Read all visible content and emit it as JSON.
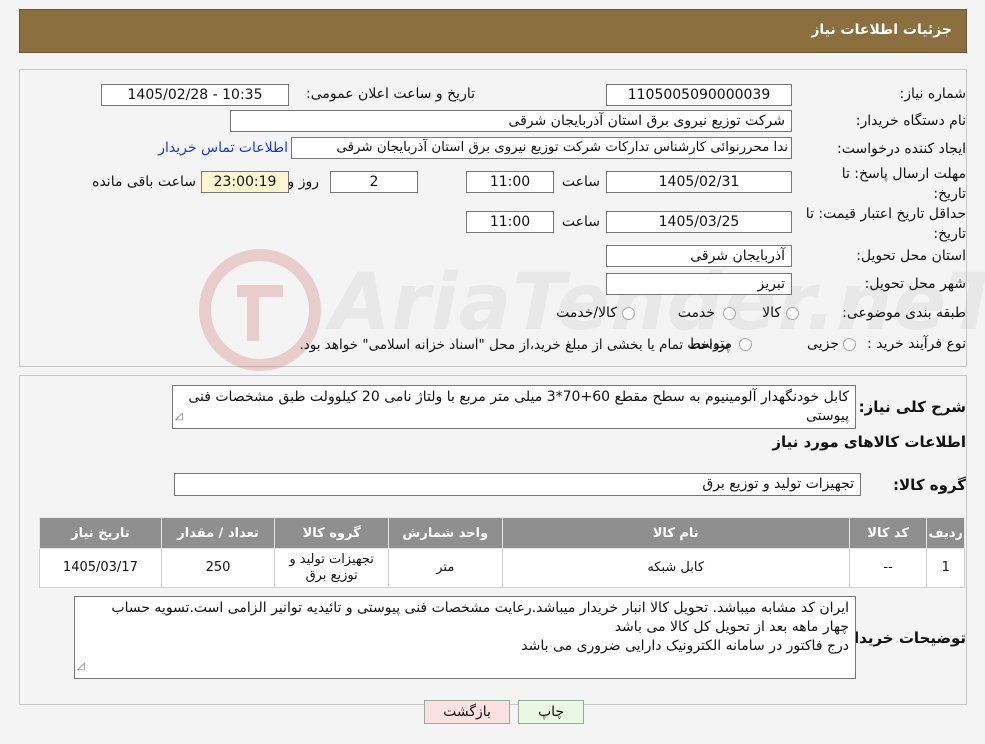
{
  "header": {
    "title": "جزئیات اطلاعات نیاز"
  },
  "info": {
    "need_number_label": "شماره نیاز:",
    "need_number": "1105005090000039",
    "announce_label": "تاریخ و ساعت اعلان عمومی:",
    "announce_value": "1405/02/28 - 10:35",
    "buyer_org_label": "نام دستگاه خریدار:",
    "buyer_org": "شرکت توزیع نیروی برق استان آذربایجان شرقی",
    "creator_label": "ایجاد کننده درخواست:",
    "creator": "ندا محررنوائی کارشناس تدارکات شرکت توزیع نیروی برق استان آذربایجان شرقی",
    "contact_link": "اطلاعات تماس خریدار",
    "deadline_label": "مهلت ارسال پاسخ: تا تاریخ:",
    "deadline_date": "1405/02/31",
    "time_label": "ساعت",
    "deadline_time": "11:00",
    "days_value": "2",
    "days_label": "روز و",
    "remaining_time": "23:00:19",
    "remaining_label": "ساعت باقی مانده",
    "price_validity_label": "حداقل تاریخ اعتبار قیمت: تا تاریخ:",
    "price_validity_date": "1405/03/25",
    "price_validity_time": "11:00",
    "province_label": "استان محل تحویل:",
    "province": "آذربایجان شرقی",
    "city_label": "شهر محل تحویل:",
    "city": "تبریز",
    "category_label": "طبقه بندی موضوعی:",
    "category_options": [
      "کالا",
      "خدمت",
      "کالا/خدمت"
    ],
    "process_label": "نوع فرآیند خرید :",
    "process_options": [
      "جزیی",
      "متوسط"
    ],
    "process_note": "پرداخت تمام یا بخشی از مبلغ خرید،از محل \"اسناد خزانه اسلامی\" خواهد بود."
  },
  "watermark": {
    "text": "AriaTender.neT"
  },
  "summary": {
    "label": "شرح کلی نیاز:",
    "text": "کابل خودنگهدار آلومینیوم به سطح مقطع 60+70*3 میلی متر مربع با ولتاژ نامی 20 کیلوولت طبق مشخصات فنی پیوستی",
    "goods_info_title": "اطلاعات کالاهای مورد نیاز",
    "goods_group_label": "گروه کالا:",
    "goods_group": "تجهیزات تولید و توزیع برق"
  },
  "table": {
    "headers": [
      "ردیف",
      "کد کالا",
      "نام کالا",
      "واحد شمارش",
      "گروه کالا",
      "تعداد / مقدار",
      "تاریخ نیاز"
    ],
    "rows": [
      [
        "1",
        "--",
        "کابل شبکه",
        "متر",
        "تجهیزات تولید و توزیع برق",
        "250",
        "1405/03/17"
      ]
    ]
  },
  "buyer_notes": {
    "label": "توضیحات خریدار:",
    "lines": [
      "ایران کد مشابه میباشد. تحویل کالا انبار خریدار میباشد.رعایت مشخصات فنی پیوستی و تائیدیه توانیر الزامی است.تسویه حساب چهار ماهه بعد از تحویل کل کالا می باشد",
      "درج فاکتور در سامانه الکترونیک دارایی ضروری می باشد"
    ]
  },
  "buttons": {
    "print": "چاپ",
    "back": "بازگشت"
  },
  "colors": {
    "header": "#8c6f3f",
    "table_header": "#8f8f8f",
    "print_btn": "#eaf7e3",
    "back_btn": "#fbe1e1"
  }
}
